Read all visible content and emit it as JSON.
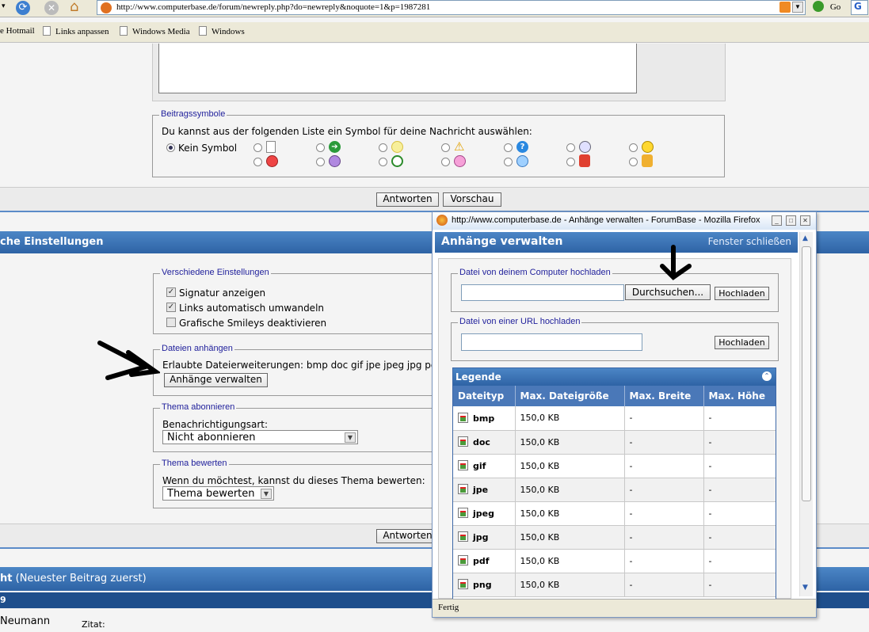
{
  "browser": {
    "url": "http://www.computerbase.de/forum/newreply.php?do=newreply&noquote=1&p=1987281",
    "go_label": "Go",
    "links": [
      "e Hotmail",
      "Links anpassen",
      "Windows Media",
      "Windows"
    ]
  },
  "post_icons": {
    "legend": "Beitragssymbole",
    "description": "Du kannst aus der folgenden Liste ein Symbol für deine Nachricht auswählen:",
    "none_label": "Kein Symbol"
  },
  "actions": {
    "reply_label": "Antworten",
    "preview_label": "Vorschau"
  },
  "settings_header": "che Einstellungen",
  "misc_settings": {
    "legend": "Verschiedene Einstellungen",
    "options": [
      {
        "label": "Signatur anzeigen",
        "checked": true
      },
      {
        "label": "Links automatisch umwandeln",
        "checked": true
      },
      {
        "label": "Grafische Smileys deaktivieren",
        "checked": false
      }
    ]
  },
  "attachments": {
    "legend": "Dateien anhängen",
    "allowed_text": "Erlaubte Dateierweiterungen: bmp doc gif jpe jpeg jpg pdf",
    "manage_button": "Anhänge verwalten"
  },
  "subscribe": {
    "legend": "Thema abonnieren",
    "label": "Benachrichtigungsart:",
    "selected": "Nicht abonnieren"
  },
  "rate": {
    "legend": "Thema bewerten",
    "label": "Wenn du möchtest, kannst du dieses Thema bewerten:",
    "selected": "Thema bewerten"
  },
  "review_header": {
    "prefix": "ht",
    "suffix": " (Neuester Beitrag zuerst)"
  },
  "subbar_text": "9",
  "post": {
    "author": "Neumann",
    "quote_label": "Zitat:"
  },
  "popup": {
    "window_title": "http://www.computerbase.de - Anhänge verwalten - ForumBase - Mozilla Firefox",
    "heading": "Anhänge verwalten",
    "close_link": "Fenster schließen",
    "upload_local": {
      "legend": "Datei von deinem Computer hochladen",
      "browse_label": "Durchsuchen...",
      "upload_label": "Hochladen"
    },
    "upload_url": {
      "legend": "Datei von einer URL hochladen",
      "upload_label": "Hochladen"
    },
    "legend_title": "Legende",
    "columns": [
      "Dateityp",
      "Max. Dateigröße",
      "Max. Breite",
      "Max. Höhe"
    ],
    "rows": [
      {
        "type": "bmp",
        "size": "150,0 KB",
        "width": "-",
        "height": "-"
      },
      {
        "type": "doc",
        "size": "150,0 KB",
        "width": "-",
        "height": "-"
      },
      {
        "type": "gif",
        "size": "150,0 KB",
        "width": "-",
        "height": "-"
      },
      {
        "type": "jpe",
        "size": "150,0 KB",
        "width": "-",
        "height": "-"
      },
      {
        "type": "jpeg",
        "size": "150,0 KB",
        "width": "-",
        "height": "-"
      },
      {
        "type": "jpg",
        "size": "150,0 KB",
        "width": "-",
        "height": "-"
      },
      {
        "type": "pdf",
        "size": "150,0 KB",
        "width": "-",
        "height": "-"
      },
      {
        "type": "png",
        "size": "150,0 KB",
        "width": "-",
        "height": "-"
      }
    ],
    "status": "Fertig"
  }
}
